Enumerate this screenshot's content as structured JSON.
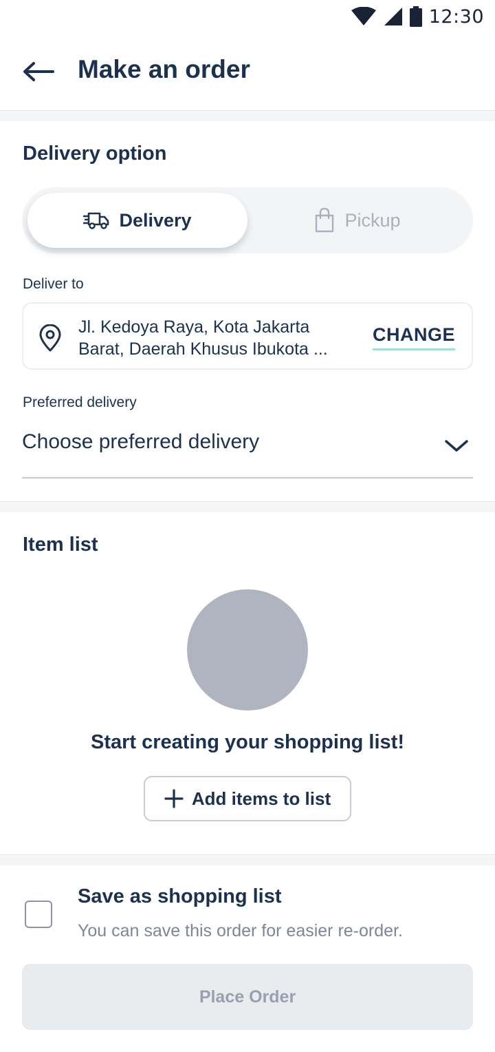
{
  "status_bar": {
    "time": "12:30",
    "icons": [
      "wifi-icon",
      "cellular-signal-icon",
      "battery-icon"
    ]
  },
  "header": {
    "back_icon": "arrow-left-icon",
    "title": "Make an order"
  },
  "delivery_section": {
    "title": "Delivery option",
    "toggle": {
      "options": [
        {
          "label": "Delivery",
          "icon": "delivery-truck-icon",
          "selected": true
        },
        {
          "label": "Pickup",
          "icon": "shopping-bag-icon",
          "selected": false
        }
      ]
    },
    "deliver_to": {
      "label": "Deliver to",
      "address_line1": "Jl. Kedoya Raya, Kota Jakarta",
      "address_line2": "Barat, Daerah Khusus Ibukota ...",
      "change_label": "CHANGE"
    },
    "preferred_delivery": {
      "label": "Preferred delivery",
      "placeholder": "Choose preferred delivery"
    }
  },
  "item_list": {
    "title": "Item list",
    "empty_title": "Start creating your shopping list!",
    "add_button_label": "Add items to list"
  },
  "save_list": {
    "checked": false,
    "title": "Save as shopping list",
    "description": "You can save this order for easier re-order."
  },
  "place_order": {
    "label": "Place Order",
    "enabled": false
  },
  "colors": {
    "primary_text": "#1c3150",
    "muted_text": "#7d8699",
    "accent_underline": "#9fe0d2",
    "illustration_placeholder": "#b0b4c1",
    "disabled_button_bg": "#e9ecef",
    "disabled_button_text": "#98a0b0"
  }
}
